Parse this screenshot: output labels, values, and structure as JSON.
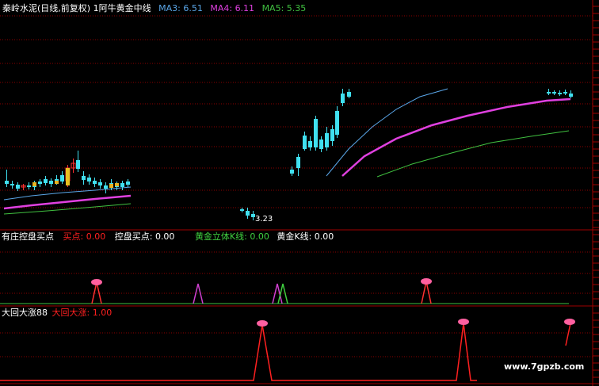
{
  "main_panel": {
    "stock_title": "秦岭水泥(日线,前复权)",
    "indicator_name": "1阿牛黄金中线",
    "ma3": {
      "label": "MA3:",
      "value": "6.51",
      "color": "#5aa6e8"
    },
    "ma4": {
      "label": "MA4:",
      "value": "6.11",
      "color": "#e040e0"
    },
    "ma5": {
      "label": "MA5:",
      "value": "5.35",
      "color": "#40c040"
    },
    "low_price_label": "3.23"
  },
  "sub_panel_1": {
    "name": "有庄控盘买点",
    "buy_point": {
      "label": "买点:",
      "value": "0.00",
      "color": "#ff2020"
    },
    "control_buy": {
      "label": "控盘买点:",
      "value": "0.00",
      "color": "#ffffff"
    },
    "gold_k3d": {
      "label": "黄金立体K线:",
      "value": "0.00",
      "color": "#40d040"
    },
    "gold_k": {
      "label": "黄金K线:",
      "value": "0.00",
      "color": "#ffffff"
    }
  },
  "sub_panel_2": {
    "name": "大回大涨88",
    "big_rise": {
      "label": "大回大涨:",
      "value": "1.00",
      "color": "#ff2020"
    }
  },
  "watermark": "www.7gpzb.com",
  "colors": {
    "grid": "#8b0000",
    "up": "#ff3030",
    "down": "#40e0f0",
    "frame": "#a00000"
  }
}
